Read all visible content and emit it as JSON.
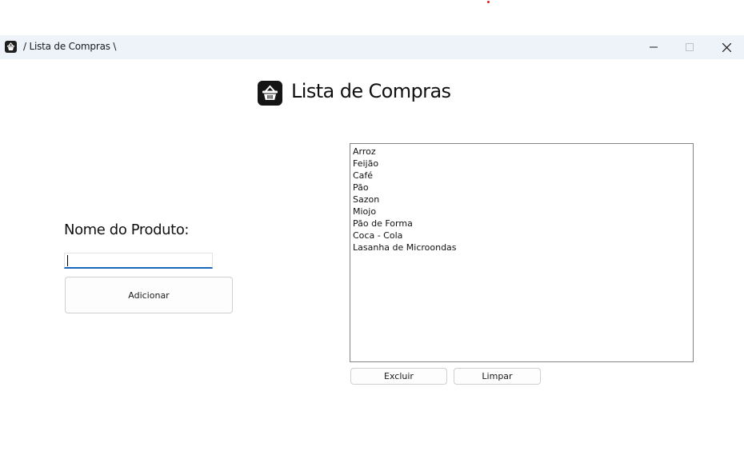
{
  "window": {
    "title": "/ Lista de Compras \\",
    "icon": "basket-icon",
    "controls": [
      "minimize-icon",
      "maximize-icon",
      "close-icon"
    ]
  },
  "header": {
    "title": "Lista de Compras",
    "icon": "basket-icon"
  },
  "form": {
    "label": "Nome do Produto:",
    "input_value": "",
    "add_label": "Adicionar"
  },
  "list": {
    "items": [
      "Arroz",
      "Feijão",
      "Café",
      "Pão",
      "Sazon",
      "Miojo",
      "Pão de Forma",
      "Coca - Cola",
      "Lasanha de Microondas"
    ],
    "delete_label": "Excluir",
    "clear_label": "Limpar"
  },
  "colors": {
    "titlebar_bg": "#eef3fa",
    "input_focus": "#1967b8",
    "logo_bg": "#151515"
  }
}
